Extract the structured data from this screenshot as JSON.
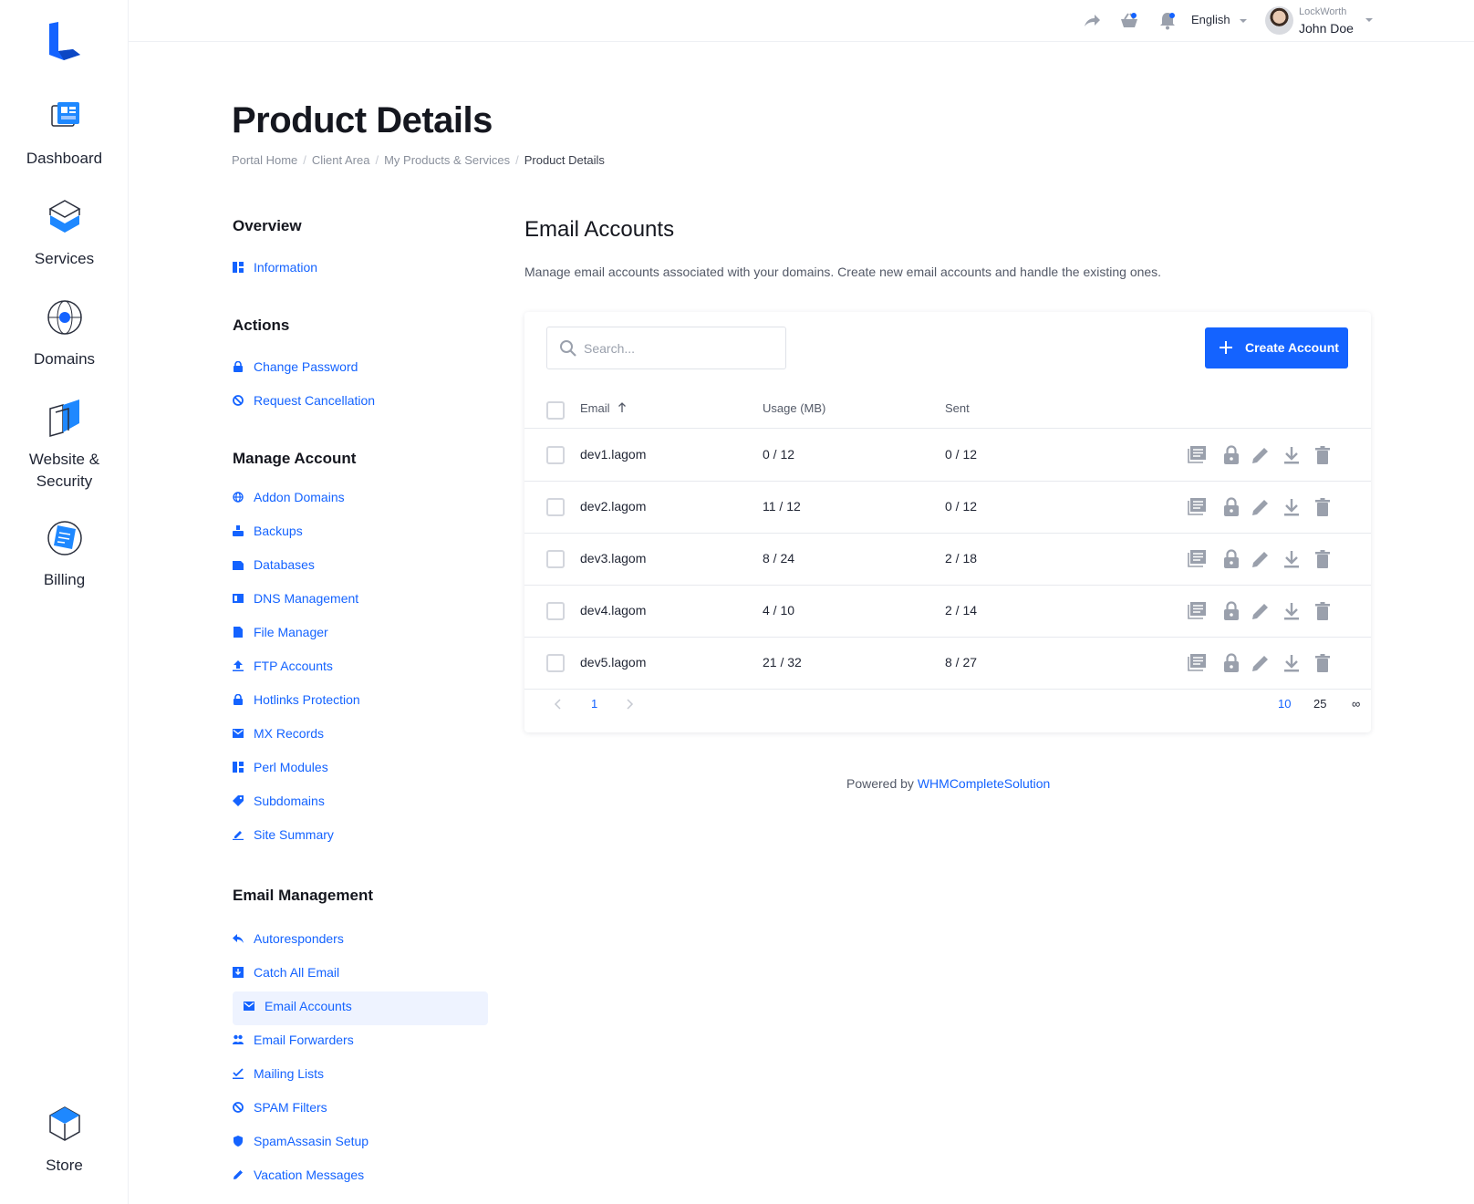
{
  "app_nav": {
    "items": [
      {
        "label": "Dashboard",
        "icon": "dashboard-icon"
      },
      {
        "label": "Services",
        "icon": "services-icon"
      },
      {
        "label": "Domains",
        "icon": "domains-icon"
      },
      {
        "label": "Website &",
        "label2": "Security",
        "icon": "website-security-icon"
      },
      {
        "label": "Billing",
        "icon": "billing-icon"
      }
    ],
    "store": {
      "label": "Store",
      "icon": "store-icon"
    }
  },
  "topbar": {
    "language": "English",
    "user_company": "LockWorth",
    "user_name": "John Doe"
  },
  "header": {
    "title": "Product Details",
    "breadcrumb": [
      "Portal Home",
      "Client Area",
      "My Products & Services",
      "Product Details"
    ]
  },
  "product_menu": {
    "overview_title": "Overview",
    "overview": [
      {
        "label": "Information",
        "icon": "grid-icon"
      }
    ],
    "actions_title": "Actions",
    "actions": [
      {
        "label": "Change Password",
        "icon": "lock-icon"
      },
      {
        "label": "Request Cancellation",
        "icon": "ban-icon"
      }
    ],
    "manage_title": "Manage Account",
    "manage": [
      {
        "label": "Addon Domains",
        "icon": "globe-icon"
      },
      {
        "label": "Backups",
        "icon": "backup-icon"
      },
      {
        "label": "Databases",
        "icon": "database-icon"
      },
      {
        "label": "DNS Management",
        "icon": "dns-icon"
      },
      {
        "label": "File Manager",
        "icon": "file-icon"
      },
      {
        "label": "FTP Accounts",
        "icon": "upload-icon"
      },
      {
        "label": "Hotlinks Protection",
        "icon": "lock-icon"
      },
      {
        "label": "MX Records",
        "icon": "mail-icon"
      },
      {
        "label": "Perl Modules",
        "icon": "grid-icon"
      },
      {
        "label": "Subdomains",
        "icon": "tag-icon"
      },
      {
        "label": "Site Summary",
        "icon": "pen-icon"
      }
    ],
    "email_title": "Email Management",
    "email": [
      {
        "label": "Autoresponders",
        "icon": "reply-icon"
      },
      {
        "label": "Catch All Email",
        "icon": "inbox-icon"
      },
      {
        "label": "Email Accounts",
        "icon": "mail-icon"
      },
      {
        "label": "Email Forwarders",
        "icon": "users-icon"
      },
      {
        "label": "Mailing Lists",
        "icon": "check-list-icon"
      },
      {
        "label": "SPAM Filters",
        "icon": "ban-icon"
      },
      {
        "label": "SpamAssasin Setup",
        "icon": "shield-icon"
      },
      {
        "label": "Vacation Messages",
        "icon": "pencil-icon"
      }
    ]
  },
  "main": {
    "title": "Email Accounts",
    "description": "Manage email accounts associated with your domains. Create new email accounts and handle the existing ones.",
    "search_placeholder": "Search...",
    "create_label": "Create Account",
    "columns": {
      "email": "Email",
      "usage": "Usage (MB)",
      "sent": "Sent"
    },
    "rows": [
      {
        "email": "dev1.lagom",
        "usage": "0 / 12",
        "sent": "0 / 12"
      },
      {
        "email": "dev2.lagom",
        "usage": "11 / 12",
        "sent": "0 / 12"
      },
      {
        "email": "dev3.lagom",
        "usage": "8 / 24",
        "sent": "2 / 18"
      },
      {
        "email": "dev4.lagom",
        "usage": "4 / 10",
        "sent": "2 / 14"
      },
      {
        "email": "dev5.lagom",
        "usage": "21 / 32",
        "sent": "8 / 27"
      }
    ],
    "pagination": {
      "current_page": "1",
      "page_sizes": [
        "10",
        "25",
        "∞"
      ]
    }
  },
  "footer": {
    "powered_prefix": "Powered by",
    "powered_link": "WHMCompleteSolution"
  },
  "colors": {
    "accent": "#1463ff",
    "text": "#1f2433",
    "muted": "#8a909c",
    "active_bg": "#eef3ff"
  }
}
